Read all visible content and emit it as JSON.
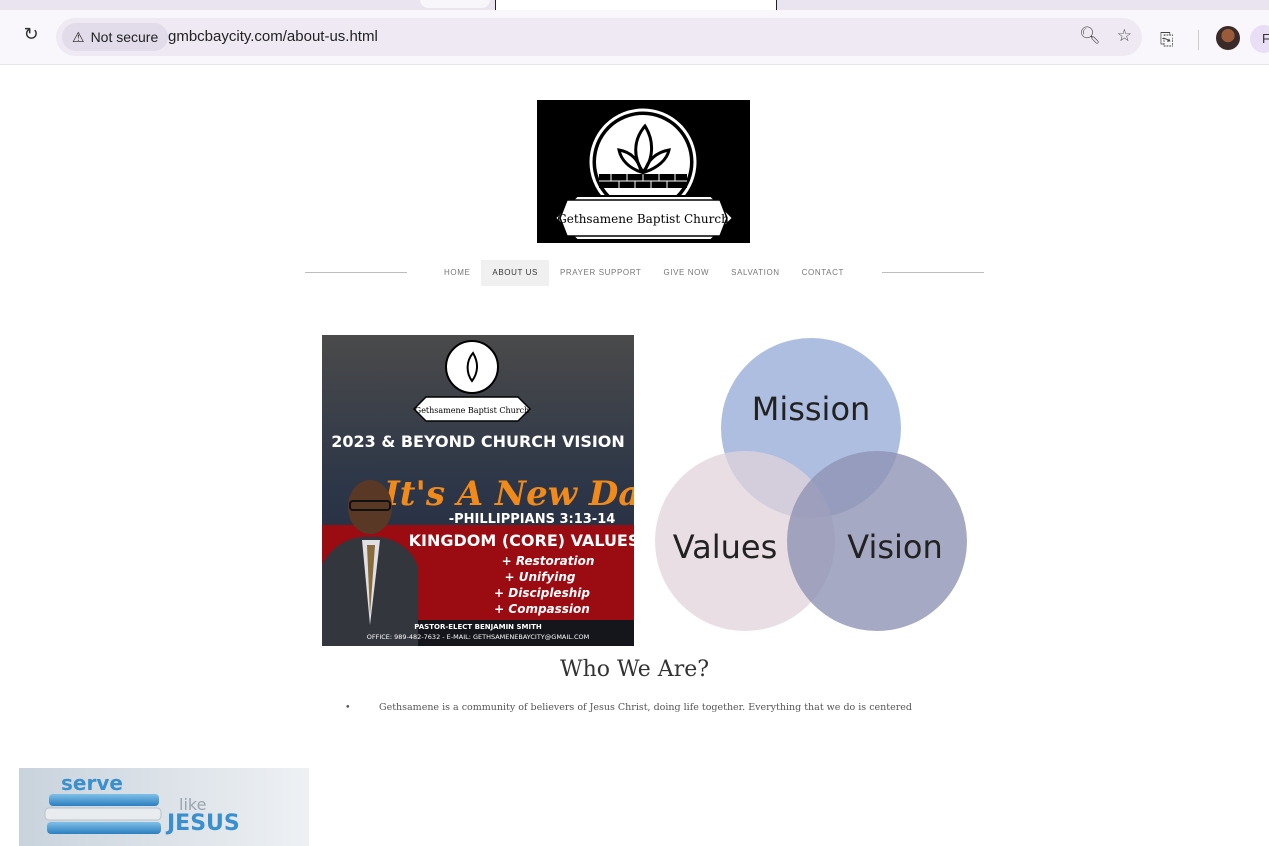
{
  "browser": {
    "security_label": "Not secure",
    "url": "gmbcbaycity.com/about-us.html",
    "profile_initial": "F"
  },
  "site": {
    "logo_text": "Gethsamene Baptist Church",
    "nav": [
      {
        "label": "HOME",
        "active": false
      },
      {
        "label": "ABOUT US",
        "active": true
      },
      {
        "label": "PRAYER SUPPORT",
        "active": false
      },
      {
        "label": "GIVE NOW",
        "active": false
      },
      {
        "label": "SALVATION",
        "active": false
      },
      {
        "label": "CONTACT",
        "active": false
      }
    ]
  },
  "flyer": {
    "church_name": "Gethsamene Baptist Church",
    "title": "2023 & BEYOND CHURCH VISION",
    "script_title": "It's A New Day",
    "verse": "-PHILLIPPIANS 3:13-14",
    "values_heading": "KINGDOM (CORE) VALUES",
    "values": [
      "+ Restoration",
      "+ Unifying",
      "+ Discipleship",
      "+ Compassion"
    ],
    "pastor": "PASTOR-ELECT BENJAMIN SMITH",
    "contact": "OFFICE: 989-482-7632 - E-MAIL: GETHSAMENEBAYCITY@GMAIL.COM"
  },
  "venn": {
    "labels": [
      "Mission",
      "Values",
      "Vision"
    ],
    "colors": {
      "mission": "#9fb3db",
      "values": "#e2d3db",
      "vision": "#8e93b4"
    }
  },
  "about": {
    "heading": "Who We Are?",
    "paragraph": "Gethsamene is a community of believers of Jesus Christ, doing life together. Everything that we do is centered"
  },
  "banner": {
    "word1": "serve",
    "word2": "like",
    "word3": "JESUS"
  }
}
